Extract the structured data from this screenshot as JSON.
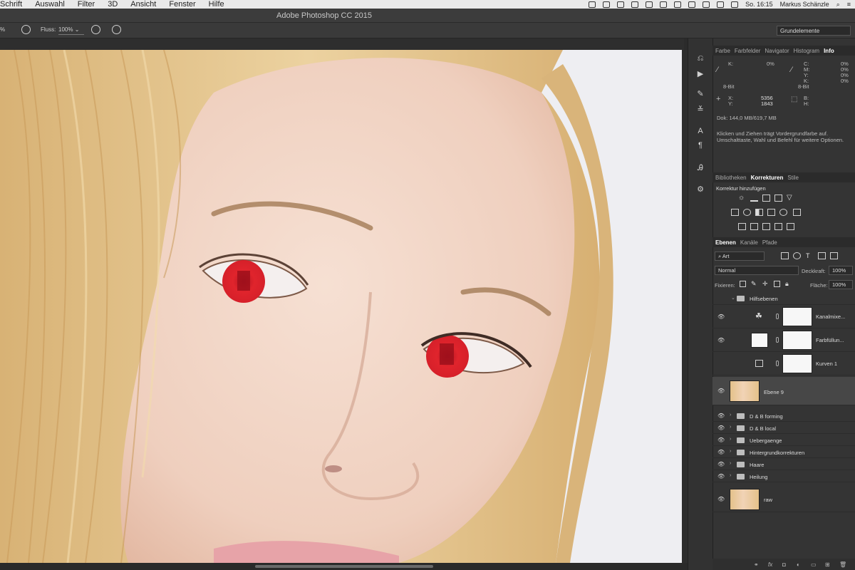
{
  "menubar": {
    "items": [
      "Schrift",
      "Auswahl",
      "Filter",
      "3D",
      "Ansicht",
      "Fenster",
      "Hilfe"
    ],
    "clock": "So. 16:15",
    "user": "Markus Schänzle"
  },
  "app": {
    "title": "Adobe Photoshop CC 2015"
  },
  "options": {
    "zoom_frag": "%",
    "flow_label": "Fluss:",
    "flow_value": "100%",
    "workspace": "Grundelemente"
  },
  "info_panel": {
    "tabs": [
      "Farbe",
      "Farbfelder",
      "Navigator",
      "Histogram",
      "Info"
    ],
    "k_label": "K:",
    "k_value": "0%",
    "cmyk_labels": [
      "C:",
      "M:",
      "Y:",
      "K:"
    ],
    "cmyk_values": [
      "0%",
      "0%",
      "0%",
      "0%"
    ],
    "bit_left": "8-Bit",
    "bit_right": "8-Bit",
    "x_label": "X:",
    "y_label": "Y:",
    "x_value": "5356",
    "y_value": "1843",
    "b_label": "B:",
    "h_label": "H:",
    "doc": "Dok: 144,0 MB/619,7 MB",
    "hint1": "Klicken und Ziehen trägt Vordergrundfarbe auf.",
    "hint2": "Umschalttaste, Wahl und Befehl für weitere Optionen."
  },
  "corrections_panel": {
    "tabs": [
      "Bibliotheken",
      "Korrekturen",
      "Stile"
    ],
    "heading": "Korrektur hinzufügen"
  },
  "layers_panel": {
    "tabs": [
      "Ebenen",
      "Kanäle",
      "Pfade"
    ],
    "filter": "Art",
    "blend_mode": "Normal",
    "opacity_label": "Deckkraft:",
    "opacity": "100%",
    "lock_label": "Fixieren:",
    "fill_label": "Fläche:",
    "fill": "100%",
    "group": "Hilfsebenen",
    "adjustments": [
      "Kanalmixe...",
      "Farbfüllun...",
      "Kurven 1"
    ],
    "selected_layer": "Ebene 9",
    "folders": [
      "D & B forming",
      "D & B local",
      "Uebergaenge",
      "Hintergrundkorrekturen",
      "Haare",
      "Heilung"
    ],
    "base_layer": "raw"
  },
  "colors": {
    "accent_eye": "#e0242c",
    "panel": "#343434"
  }
}
